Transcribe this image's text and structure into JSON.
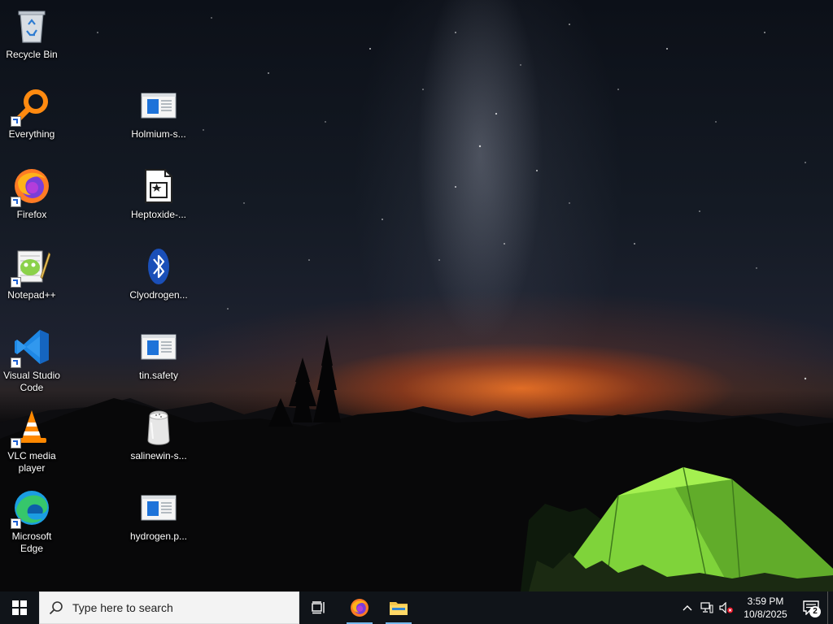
{
  "desktop": {
    "icons": [
      {
        "label": "Recycle Bin"
      },
      {
        "label": "Everything"
      },
      {
        "label": "Firefox"
      },
      {
        "label": "Notepad++"
      },
      {
        "label": "Visual Studio Code"
      },
      {
        "label": "VLC media player"
      },
      {
        "label": "Microsoft Edge"
      },
      {
        "label": "Holmium-s..."
      },
      {
        "label": "Heptoxide-..."
      },
      {
        "label": "Clyodrogen..."
      },
      {
        "label": "tin.safety"
      },
      {
        "label": "salinewin-s..."
      },
      {
        "label": "hydrogen.p..."
      }
    ]
  },
  "taskbar": {
    "search_placeholder": "Type here to search",
    "pinned": [
      "task-view",
      "firefox",
      "file-explorer"
    ],
    "clock_time": "3:59 PM",
    "clock_date": "10/8/2025",
    "notification_count": "2"
  },
  "colors": {
    "taskbar_bg": "#101419",
    "active_indicator": "#76b9ed",
    "tent_green": "#8ee03a"
  }
}
